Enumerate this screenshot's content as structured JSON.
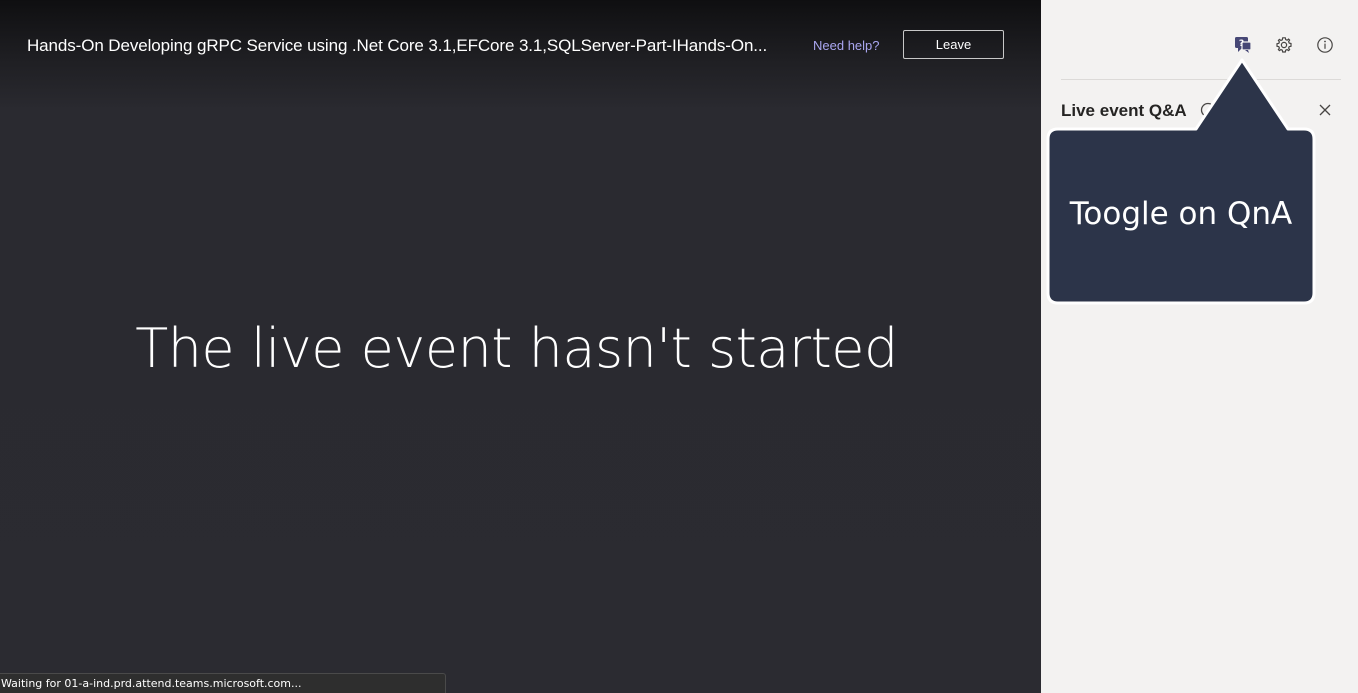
{
  "header": {
    "title": "Hands-On Developing gRPC Service using .Net Core 3.1,EFCore 3.1,SQLServer-Part-IHands-On...",
    "help_link": "Need help?",
    "leave_label": "Leave"
  },
  "main": {
    "message": "The live event hasn't started"
  },
  "status_bar": {
    "text": "Waiting for 01-a-ind.prd.attend.teams.microsoft.com..."
  },
  "side_panel": {
    "title": "Live event Q&A",
    "icons": [
      "qna-icon",
      "gear-icon",
      "info-icon",
      "close-icon"
    ]
  },
  "callout": {
    "text": "Toogle on QnA",
    "color": "#2c3449"
  },
  "colors": {
    "stage_bg": "#2b2b31",
    "panel_bg": "#f3f2f1",
    "accent_link": "#a9a6f0",
    "qna_icon": "#464775"
  }
}
